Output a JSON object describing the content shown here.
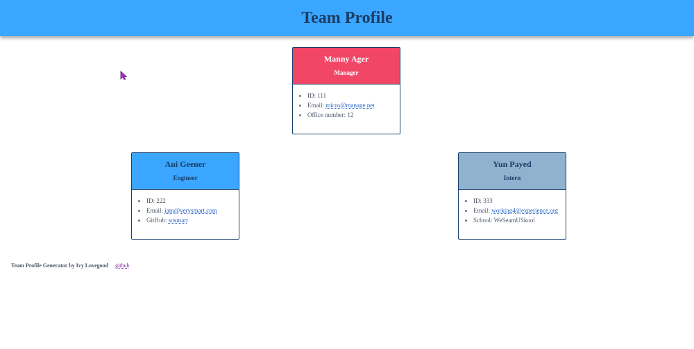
{
  "header": {
    "title": "Team Profile"
  },
  "cards": {
    "manager": {
      "name": "Manny Ager",
      "role": "Manager",
      "id_label": "ID:",
      "id": "111",
      "email_label": "Email:",
      "email": "micro@manage.net",
      "extra_label": "Office number:",
      "extra": "12"
    },
    "engineer": {
      "name": "Ani Geener",
      "role": "Engineer",
      "id_label": "ID:",
      "id": "222",
      "email_label": "Email:",
      "email": "iam@verysmart.com",
      "extra_label": "GitHub:",
      "extra": "sosmart"
    },
    "intern": {
      "name": "Yun Payed",
      "role": "Intern",
      "id_label": "ID:",
      "id": "333",
      "email_label": "Email:",
      "email": "working4@experience.org",
      "extra_label": "School:",
      "extra": "WeSeamUSkool"
    }
  },
  "footer": {
    "credit": "Team Profile Generator by Ivy Lovegood",
    "link": "github"
  },
  "colors": {
    "header": "#3ba6ff",
    "manager": "#f24667",
    "engineer": "#3ba6ff",
    "intern": "#8fb2cf",
    "border": "#1c3f6e"
  },
  "icons": {
    "cursor": "mouse-pointer-icon"
  }
}
